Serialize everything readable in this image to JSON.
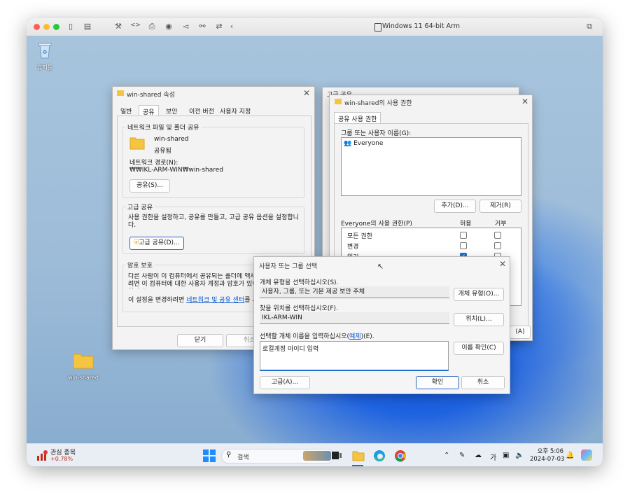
{
  "mac": {
    "title": "Windows 11 64-bit Arm",
    "toolbar_icons": [
      "sidebar-icon",
      "snapshot-icon",
      "wrench-icon",
      "code-icon",
      "printer-icon",
      "camera-icon",
      "speaker-icon",
      "usb-icon",
      "share-icon",
      "back-icon"
    ]
  },
  "desktop": {
    "recycle_bin_label": "휴지통",
    "folder_label": "win-shared"
  },
  "props": {
    "title": "win-shared 속성",
    "tabs": [
      "일반",
      "공유",
      "보안",
      "이전 버전",
      "사용자 지정"
    ],
    "network_group": "네트워크 파일 및 폴더 공유",
    "folder_name": "win-shared",
    "folder_state": "공유됨",
    "network_path_label": "네트워크 경로(N):",
    "network_path": "₩₩IKL-ARM-WIN₩win-shared",
    "share_button": "공유(S)...",
    "advanced_group": "고급 공유",
    "advanced_desc": "사용 권한을 설정하고, 공유를 만들고, 고급 공유 옵션을 설정합니다.",
    "advanced_button": "고급 공유(D)...",
    "password_group": "암호 보호",
    "password_desc": "다른 사람이 이 컴퓨터에서 공유되는 폴더에 액세스하려면 이 컴퓨터에 대한 사용자 계정과 암호가 있어야 합니다.",
    "password_change_prefix": "이 설정을 변경하려면",
    "password_link": "네트워크 및 공유 센터",
    "password_change_suffix": "를 사용하세요.",
    "close_button": "닫기",
    "cancel_button": "취소"
  },
  "adv_behind": {
    "title": "고급 공유"
  },
  "perms": {
    "title": "win-shared의 사용 권한",
    "tab": "공유 사용 권한",
    "group_label": "그룹 또는 사용자 이름(G):",
    "users": [
      "Everyone"
    ],
    "add_button": "추가(D)...",
    "remove_button": "제거(R)",
    "perm_label": "Everyone의 사용 권한(P)",
    "allow_header": "허용",
    "deny_header": "거부",
    "rows": [
      {
        "name": "모든 권한",
        "allow": false,
        "deny": false
      },
      {
        "name": "변경",
        "allow": false,
        "deny": false
      },
      {
        "name": "읽기",
        "allow": true,
        "deny": false
      }
    ],
    "apply_button": "(A)"
  },
  "select": {
    "title": "사용자 또는 그룹 선택",
    "type_label": "개체 유형을 선택하십시오(S).",
    "type_value": "사용자, 그룹, 또는 기본 제공 보안 주체",
    "type_button": "개체 유형(O)...",
    "loc_label": "찾을 위치를 선택하십시오(F).",
    "loc_value": "IKL-ARM-WIN",
    "loc_button": "위치(L)...",
    "names_label_prefix": "선택할 개체 이름을 입력하십시오(",
    "names_label_link": "예제",
    "names_label_suffix": ")(E).",
    "names_value": "로컬계정 아이디 입력",
    "check_button": "이름 확인(C)",
    "advanced_button": "고급(A)...",
    "ok_button": "확인",
    "cancel_button": "취소"
  },
  "taskbar": {
    "widget_title": "관심 종목",
    "widget_value": "+0.78%",
    "search_placeholder": "검색",
    "ime": "가",
    "time": "오후 5:06",
    "date": "2024-07-03"
  },
  "colors": {
    "accent": "#1f6fd1",
    "widget_red": "#c42b1c"
  }
}
